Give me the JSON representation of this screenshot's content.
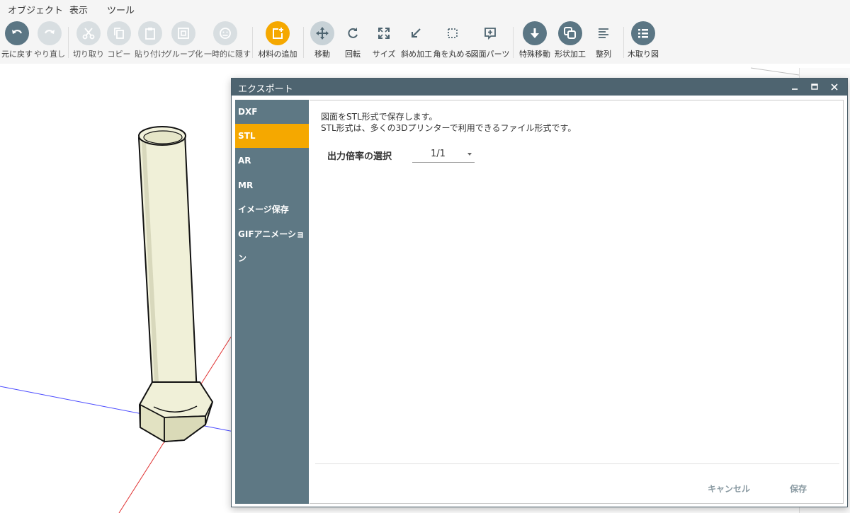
{
  "menu": [
    "オブジェクト",
    "表示",
    "ツール"
  ],
  "toolbar": [
    {
      "label": "元に戻す",
      "icon": "undo-icon"
    },
    {
      "label": "やり直し",
      "icon": "redo-icon"
    },
    {
      "label": "切り取り",
      "icon": "cut-icon"
    },
    {
      "label": "コピー",
      "icon": "copy-icon"
    },
    {
      "label": "貼り付け",
      "icon": "paste-icon"
    },
    {
      "label": "グループ化",
      "icon": "group-icon"
    },
    {
      "label": "一時的に隠す",
      "icon": "hide-icon"
    },
    {
      "label": "材料の追加",
      "icon": "add-material-icon"
    },
    {
      "label": "移動",
      "icon": "move-icon"
    },
    {
      "label": "回転",
      "icon": "rotate-icon"
    },
    {
      "label": "サイズ",
      "icon": "resize-icon"
    },
    {
      "label": "斜め加工",
      "icon": "bevel-icon"
    },
    {
      "label": "角を丸める",
      "icon": "round-corner-icon"
    },
    {
      "label": "図面パーツ",
      "icon": "drawing-parts-icon"
    },
    {
      "label": "特殊移動",
      "icon": "special-move-icon"
    },
    {
      "label": "形状加工",
      "icon": "shape-process-icon"
    },
    {
      "label": "整列",
      "icon": "align-icon"
    },
    {
      "label": "木取り図",
      "icon": "cutting-list-icon"
    }
  ],
  "dialog": {
    "title": "エクスポート",
    "sidebar": [
      "DXF",
      "STL",
      "AR",
      "MR",
      "イメージ保存",
      "GIFアニメーション"
    ],
    "active_index": 1,
    "description": [
      "図面をSTL形式で保存します。",
      "STL形式は、多くの3Dプリンターで利用できるファイル形式です。"
    ],
    "field_label": "出力倍率の選択",
    "scale_value": "1/1",
    "cancel_label": "キャンセル",
    "save_label": "保存"
  },
  "colors": {
    "accent": "#f5a800",
    "sidebar": "#5e7884",
    "titlebar": "#4e6470",
    "tool_icon": "#5b7684"
  }
}
